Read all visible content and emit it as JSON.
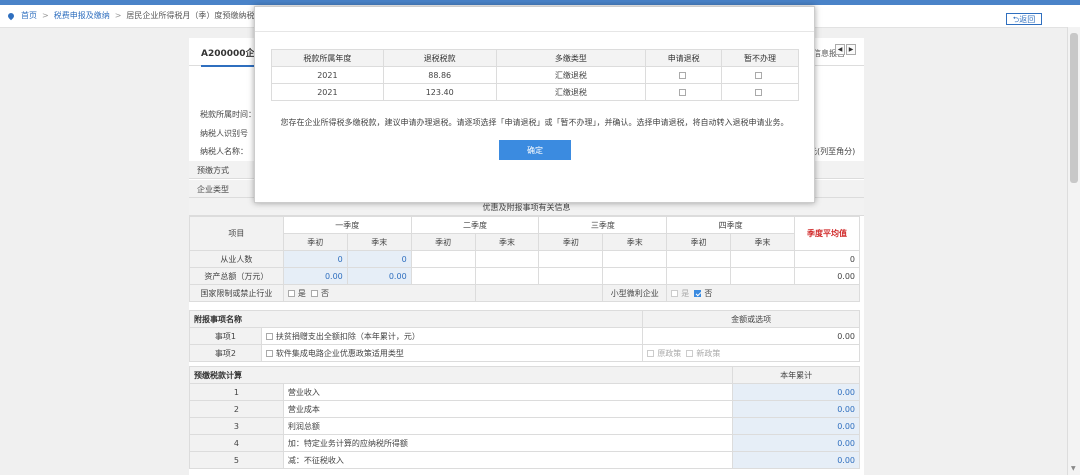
{
  "breadcrumb": {
    "home": "首页",
    "level2": "税费申报及缴纳",
    "current": "居民企业所得税月（季）度预缴纳税申"
  },
  "back_button": "返回",
  "form": {
    "tab_active": "A200000企",
    "tab_right": "信息报告",
    "info_period": "税款所属时间：",
    "info_taxid": "纳税人识别号",
    "info_name": "纳税人名称：",
    "unit_suffix": "元(列至角分)",
    "row_prepay_method": "预缴方式",
    "row_enterprise_type": "企业类型",
    "section_title": "优惠及附报事项有关信息",
    "table": {
      "item_header": "项目",
      "quarters": [
        "一季度",
        "二季度",
        "三季度",
        "四季度"
      ],
      "sub_start": "季初",
      "sub_end": "季末",
      "avg_header": "季度平均值",
      "employees_label": "从业人数",
      "employees_q1_start": "0",
      "employees_q1_end": "0",
      "employees_avg": "0",
      "assets_label": "资产总额（万元）",
      "assets_q1_start": "0.00",
      "assets_q1_end": "0.00",
      "assets_avg": "0.00",
      "restricted_label": "国家限制或禁止行业",
      "yes": "是",
      "no": "否",
      "small_label": "小型微利企业"
    },
    "attach": {
      "header_name": "附报事项名称",
      "header_amount": "金额或选项",
      "item1_label": "事项1",
      "item1_text": "扶贫捐赠支出全额扣除（本年累计，元）",
      "item1_value": "0.00",
      "item2_label": "事项2",
      "item2_text": "软件集成电路企业优惠政策适用类型",
      "item2_opt1": "原政策",
      "item2_opt2": "新政策"
    },
    "calc": {
      "header": "预缴税款计算",
      "header_total": "本年累计",
      "rows": [
        {
          "no": "1",
          "label": "营业收入",
          "value": "0.00"
        },
        {
          "no": "2",
          "label": "营业成本",
          "value": "0.00"
        },
        {
          "no": "3",
          "label": "利润总额",
          "value": "0.00"
        },
        {
          "no": "4",
          "label": "加：特定业务计算的应纳税所得额",
          "value": "0.00"
        },
        {
          "no": "5",
          "label": "减：不征税收入",
          "value": "0.00"
        }
      ]
    }
  },
  "modal": {
    "headers": [
      "税款所属年度",
      "退税税款",
      "多缴类型",
      "申请退税",
      "暂不办理"
    ],
    "rows": [
      {
        "year": "2021",
        "amount": "88.86",
        "type": "汇缴退税"
      },
      {
        "year": "2021",
        "amount": "123.40",
        "type": "汇缴退税"
      }
    ],
    "message": "您存在企业所得税多缴税款，建议申请办理退税。请逐项选择「申请退税」或「暂不办理」，并确认。选择申请退税，将自动转入退税申请业务。",
    "ok_label": "确定"
  }
}
